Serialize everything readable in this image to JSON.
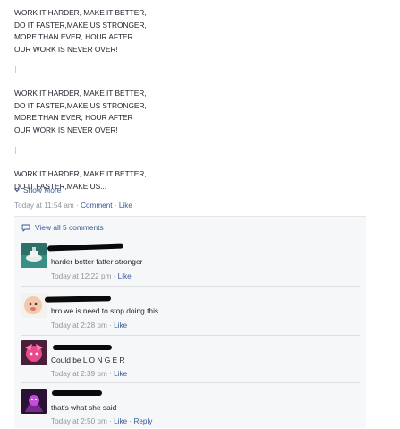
{
  "post": {
    "paragraphs": [
      {
        "lines": [
          "WORK IT HARDER, MAKE IT BETTER,",
          "DO IT FASTER,MAKE US STRONGER,",
          "MORE THAN EVER, HOUR AFTER",
          "OUR WORK IS NEVER OVER!"
        ]
      },
      {
        "lines": [
          "WORK IT HARDER, MAKE IT BETTER,",
          "DO IT FASTER,MAKE US STRONGER,",
          "MORE THAN EVER, HOUR AFTER",
          "OUR WORK IS NEVER OVER!"
        ]
      },
      {
        "lines": [
          "WORK IT HARDER, MAKE IT BETTER,",
          "DO IT FASTER,MAKE US..."
        ]
      }
    ],
    "show_more": "Show More",
    "timestamp": "Today at 11:54 am",
    "comment_action": "Comment",
    "like_action": "Like",
    "dot": "·"
  },
  "comments_section": {
    "view_all": "View all 5 comments",
    "comments": [
      {
        "text": "harder better fatter stronger",
        "time": "Today at 12:22 pm",
        "like": "Like",
        "reply": ""
      },
      {
        "text": "bro we is need to stop doing this",
        "time": "Today at 2:28 pm",
        "like": "Like",
        "reply": ""
      },
      {
        "text": "Could be L O N G E R",
        "time": "Today at 2:39 pm",
        "like": "Like",
        "reply": ""
      },
      {
        "text": "that's what she said",
        "time": "Today at 2:50 pm",
        "like": "Like",
        "reply": "Reply"
      }
    ]
  },
  "colors": {
    "link": "#365899",
    "meta": "#90949c",
    "text": "#1d2129",
    "panel": "#f6f7f9"
  },
  "icons": {
    "show_more": "chevron-down-icon",
    "view_all": "comment-bubble-icon"
  }
}
